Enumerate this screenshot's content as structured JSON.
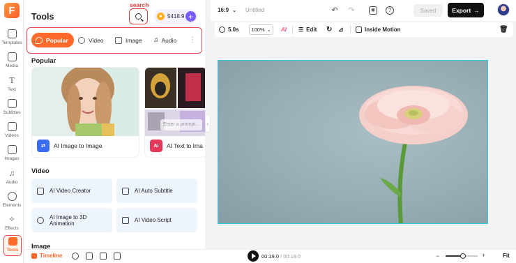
{
  "app": {
    "logo_letter": "F",
    "colors": {
      "accent": "#ff6a2a",
      "highlight": "#e24b4b",
      "selection": "#38c4e0",
      "purple": "#7a5cff"
    }
  },
  "rail": {
    "items": [
      {
        "label": "Templates",
        "icon": "templates-icon"
      },
      {
        "label": "Media",
        "icon": "media-icon"
      },
      {
        "label": "Text",
        "icon": "text-icon"
      },
      {
        "label": "Subtitles",
        "icon": "subtitles-icon"
      },
      {
        "label": "Videos",
        "icon": "videos-icon"
      },
      {
        "label": "Images",
        "icon": "images-icon"
      },
      {
        "label": "Audio",
        "icon": "audio-icon"
      },
      {
        "label": "Elements",
        "icon": "elements-icon"
      },
      {
        "label": "Effects",
        "icon": "effects-icon"
      },
      {
        "label": "Tools",
        "icon": "tools-icon",
        "active": true
      }
    ]
  },
  "panel": {
    "title": "Tools",
    "search_label": "search",
    "credits": "5418.9",
    "plus": "+",
    "tabs": [
      {
        "label": "Popular",
        "active": true
      },
      {
        "label": "Video"
      },
      {
        "label": "Image"
      },
      {
        "label": "Audio"
      }
    ],
    "popular_heading": "Popular",
    "popular_cards": [
      {
        "label": "AI Image to Image"
      },
      {
        "label": "AI Text to Ima",
        "prompt_placeholder": "Enter a prompt..."
      }
    ],
    "video_heading": "Video",
    "video_tools": [
      {
        "label": "AI Video Creator"
      },
      {
        "label": "AI Auto Subtitle"
      },
      {
        "label": "AI Image to 3D Animation"
      },
      {
        "label": "AI Video Script"
      }
    ],
    "image_heading": "Image"
  },
  "topbar": {
    "ratio": "16:9",
    "project_name": "Untitled",
    "saved": "Saved",
    "export": "Export"
  },
  "toolbar": {
    "duration": "5.0s",
    "zoom": "100%",
    "ai_label": "AI",
    "edit": "Edit",
    "inside_motion": "Inside Motion"
  },
  "bottombar": {
    "timeline": "Timeline",
    "current_time": "00:19.0",
    "separator": " / ",
    "total_time": "00:19.0",
    "zoom_level": 0.55,
    "fit": "Fit"
  }
}
